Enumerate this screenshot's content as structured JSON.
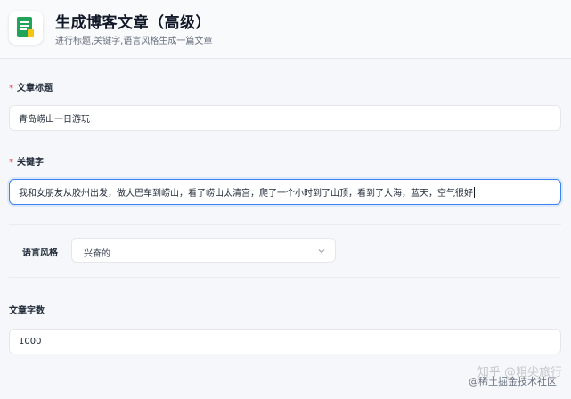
{
  "header": {
    "title": "生成博客文章（高级）",
    "subtitle": "进行标题,关键字,语言风格生成一篇文章",
    "icon": "document-icon"
  },
  "form": {
    "title_field": {
      "required_mark": "*",
      "label": "文章标题",
      "value": "青岛崂山一日游玩"
    },
    "keywords_field": {
      "required_mark": "*",
      "label": "关键字",
      "value": "我和女朋友从胶州出发，做大巴车到崂山，看了崂山太清宫，爬了一个小时到了山顶，看到了大海，蓝天，空气很好"
    },
    "style_field": {
      "label": "语言风格",
      "selected": "兴奋的"
    },
    "word_count_field": {
      "label": "文章字数",
      "value": "1000"
    }
  },
  "watermark": {
    "text": "知乎 @粗尖旅行",
    "community": "@稀土掘金技术社区"
  },
  "colors": {
    "accent": "#3b82f6",
    "required": "#ef4444",
    "icon_green": "#22a35a",
    "icon_yellow": "#f5c518"
  }
}
